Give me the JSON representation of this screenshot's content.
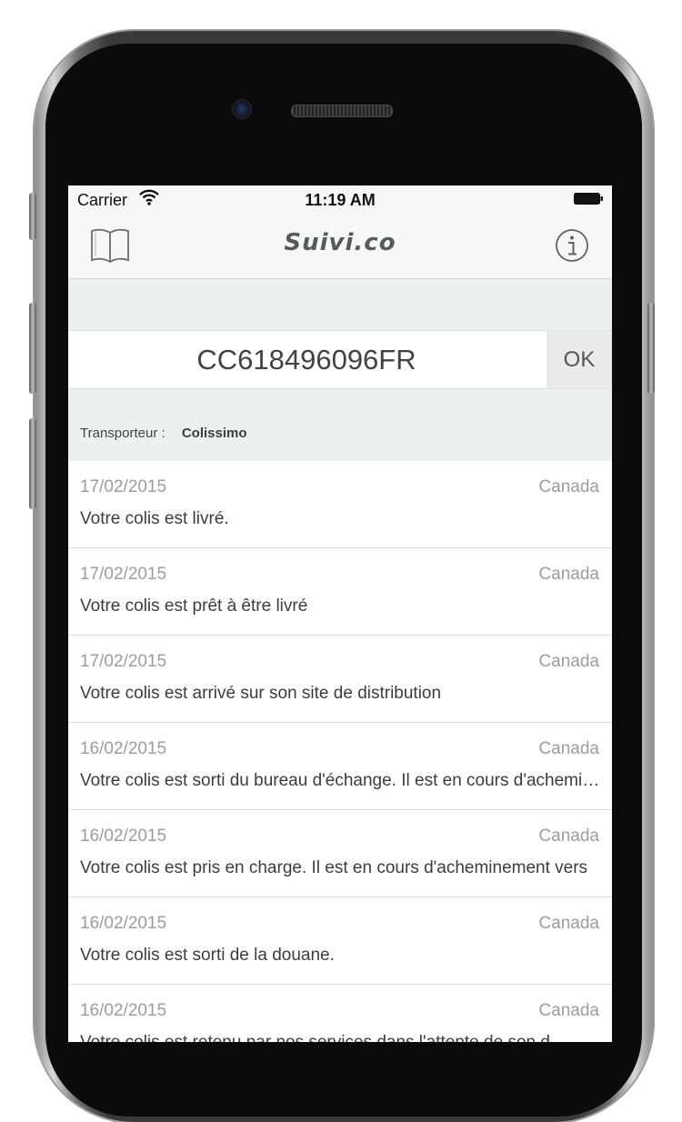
{
  "status_bar": {
    "carrier": "Carrier",
    "time": "11:19 AM"
  },
  "nav": {
    "title": "Suivi.co",
    "left_icon": "book-icon",
    "right_icon": "info-icon"
  },
  "search": {
    "tracking_number": "CC618496096FR",
    "ok_label": "OK"
  },
  "carrier": {
    "label": "Transporteur :",
    "name": "Colissimo"
  },
  "events": [
    {
      "date": "17/02/2015",
      "location": "Canada",
      "message": "Votre colis est livré."
    },
    {
      "date": "17/02/2015",
      "location": "Canada",
      "message": "Votre colis est prêt à être livré"
    },
    {
      "date": "17/02/2015",
      "location": "Canada",
      "message": "Votre colis est arrivé sur son site de distribution"
    },
    {
      "date": "16/02/2015",
      "location": "Canada",
      "message": "Votre colis est sorti du bureau d'échange. Il est en cours d'acheminement"
    },
    {
      "date": "16/02/2015",
      "location": "Canada",
      "message": "Votre colis est pris en charge. Il est en cours d'acheminement vers"
    },
    {
      "date": "16/02/2015",
      "location": "Canada",
      "message": "Votre colis est sorti de la douane."
    },
    {
      "date": "16/02/2015",
      "location": "Canada",
      "message": "Votre colis est retenu par nos services dans l'attente de son d"
    }
  ],
  "colors": {
    "bar_background": "#f6f7f7",
    "search_background": "#ecf0f0",
    "secondary_text": "#9a9d9f"
  }
}
